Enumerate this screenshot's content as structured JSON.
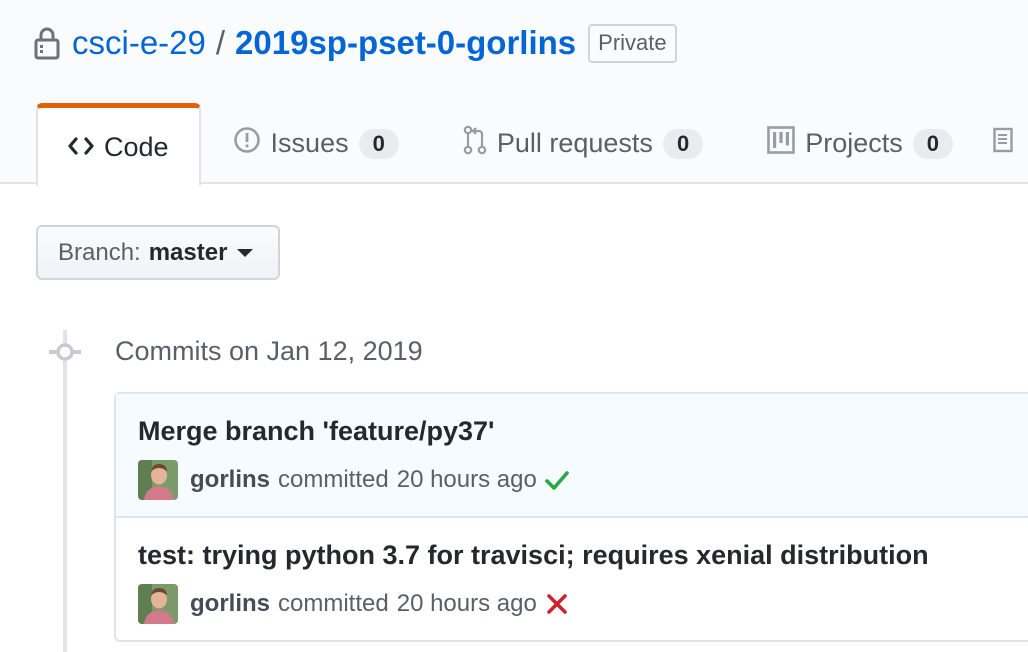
{
  "repo": {
    "owner": "csci-e-29",
    "separator": "/",
    "name": "2019sp-pset-0-gorlins",
    "visibility": "Private"
  },
  "tabs": [
    {
      "label": "Code",
      "icon": "code-icon",
      "selected": true
    },
    {
      "label": "Issues",
      "icon": "issue-icon",
      "count": "0"
    },
    {
      "label": "Pull requests",
      "icon": "pull-request-icon",
      "count": "0"
    },
    {
      "label": "Projects",
      "icon": "project-icon",
      "count": "0"
    }
  ],
  "branch": {
    "label": "Branch:",
    "value": "master"
  },
  "commits_group": {
    "date_heading": "Commits on Jan 12, 2019",
    "commits": [
      {
        "title": "Merge branch 'feature/py37'",
        "author": "gorlins",
        "action": "committed",
        "time": "20 hours ago",
        "status": "success",
        "status_icon": "check-icon"
      },
      {
        "title": "test: trying python 3.7 for travisci; requires xenial distribution",
        "author": "gorlins",
        "action": "committed",
        "time": "20 hours ago",
        "status": "failure",
        "status_icon": "x-icon"
      }
    ]
  },
  "colors": {
    "link": "#0366d6",
    "tab_accent": "#e36209",
    "success": "#28a745",
    "failure": "#cb2431"
  }
}
